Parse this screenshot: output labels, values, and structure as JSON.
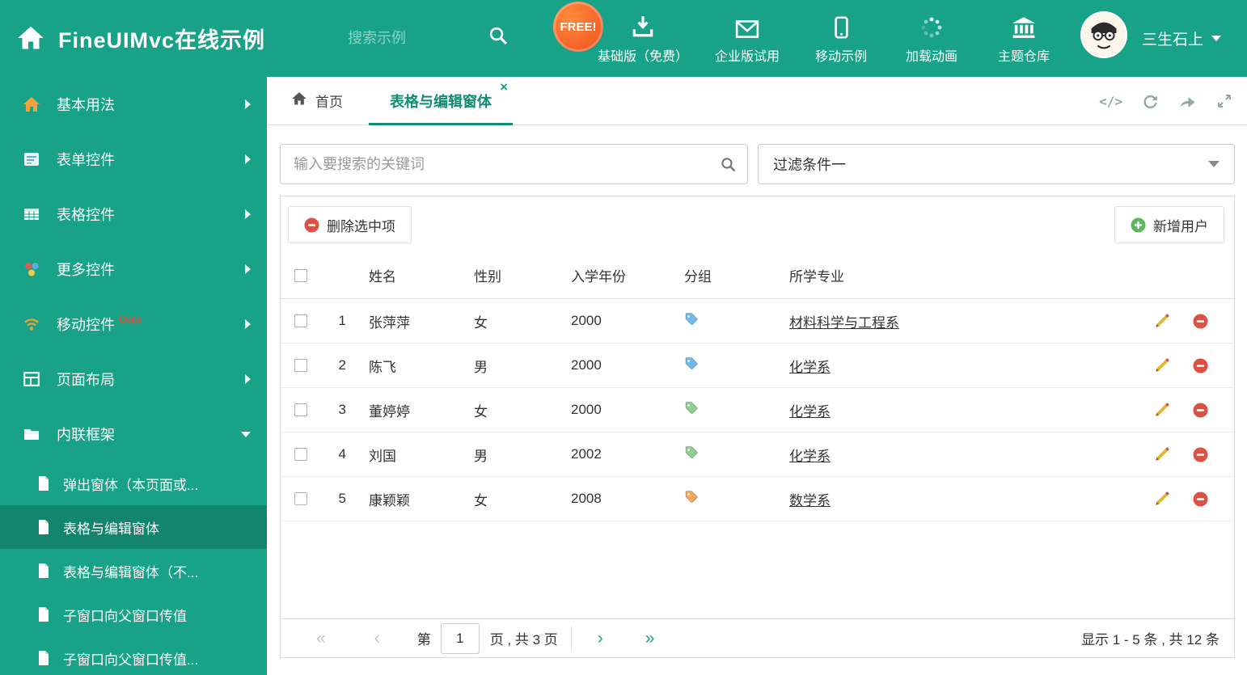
{
  "theme": {
    "primary": "#18A287",
    "active_tab": "#0E8C74",
    "danger": "#DD5044",
    "success": "#5CB85C"
  },
  "header": {
    "app_title": "FineUIMvc在线示例",
    "search_placeholder": "搜索示例",
    "free_badge": "FREE!",
    "nav_items": [
      {
        "label": "基础版（免费）",
        "icon": "download-icon"
      },
      {
        "label": "企业版试用",
        "icon": "envelope-icon"
      },
      {
        "label": "移动示例",
        "icon": "mobile-icon"
      },
      {
        "label": "加载动画",
        "icon": "spinner-icon"
      },
      {
        "label": "主题仓库",
        "icon": "bank-icon"
      }
    ],
    "user_name": "三生石上"
  },
  "sidebar": {
    "items": [
      {
        "label": "基本用法"
      },
      {
        "label": "表单控件"
      },
      {
        "label": "表格控件"
      },
      {
        "label": "更多控件"
      },
      {
        "label": "移动控件",
        "badge": "Corp"
      },
      {
        "label": "页面布局"
      },
      {
        "label": "内联框架"
      }
    ],
    "subitems": [
      {
        "label": "弹出窗体（本页面或..."
      },
      {
        "label": "表格与编辑窗体"
      },
      {
        "label": "表格与编辑窗体（不..."
      },
      {
        "label": "子窗口向父窗口传值"
      },
      {
        "label": "子窗口向父窗口传值..."
      }
    ]
  },
  "tabs": {
    "home": "首页",
    "active": "表格与编辑窗体",
    "close_glyph": "×"
  },
  "filter": {
    "search_placeholder": "输入要搜索的关键词",
    "selected_filter": "过滤条件一"
  },
  "toolbar": {
    "delete_label": "删除选中项",
    "add_label": "新增用户"
  },
  "table": {
    "columns": [
      "姓名",
      "性别",
      "入学年份",
      "分组",
      "所学专业"
    ],
    "rows": [
      {
        "num": "1",
        "name": "张萍萍",
        "gender": "女",
        "year": "2000",
        "tag_color": "#6EBBE8",
        "major": "材料科学与工程系"
      },
      {
        "num": "2",
        "name": "陈飞",
        "gender": "男",
        "year": "2000",
        "tag_color": "#6EBBE8",
        "major": "化学系"
      },
      {
        "num": "3",
        "name": "董婷婷",
        "gender": "女",
        "year": "2000",
        "tag_color": "#8FCE8F",
        "major": "化学系"
      },
      {
        "num": "4",
        "name": "刘国",
        "gender": "男",
        "year": "2002",
        "tag_color": "#8FCE8F",
        "major": "化学系"
      },
      {
        "num": "5",
        "name": "康颖颖",
        "gender": "女",
        "year": "2008",
        "tag_color": "#F2A95C",
        "major": "数学系"
      }
    ]
  },
  "pagination": {
    "first_glyph": "«",
    "prev_glyph": "‹",
    "next_glyph": "›",
    "last_glyph": "»",
    "label_page": "第",
    "current_page": "1",
    "label_total": "页 , 共 3 页",
    "summary": "显示 1 - 5 条 , 共 12 条"
  }
}
